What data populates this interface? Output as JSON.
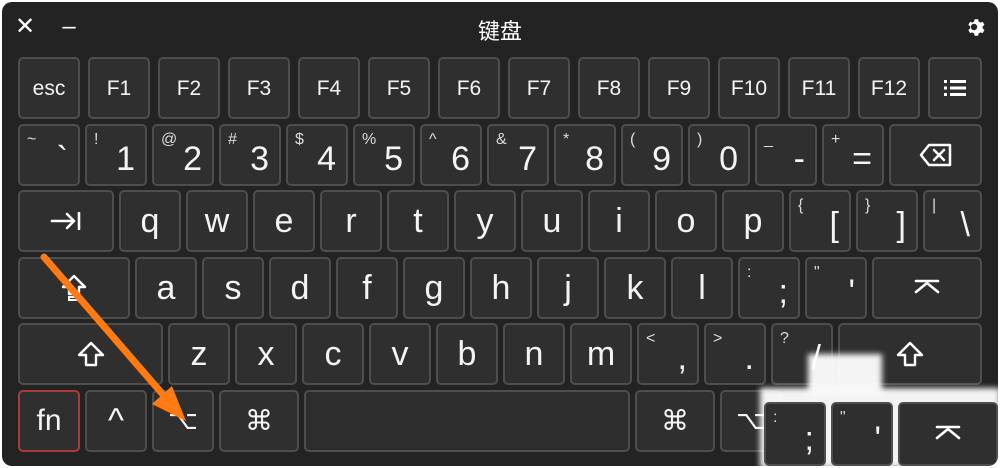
{
  "window": {
    "title": "键盘",
    "close_glyph": "✕",
    "minimize_glyph": "–",
    "settings_icon": "gear-icon"
  },
  "colors": {
    "background": "#232323",
    "key_fill": "#2f2f2f",
    "key_border": "#4e4e4e",
    "fn_border": "#a83b3b",
    "arrow": "#ff7a12"
  },
  "keys": {
    "row1": [
      "esc",
      "F1",
      "F2",
      "F3",
      "F4",
      "F5",
      "F6",
      "F7",
      "F8",
      "F9",
      "F10",
      "F11",
      "F12"
    ],
    "row2": [
      {
        "sym": "~",
        "main": "`"
      },
      {
        "sym": "!",
        "main": "1"
      },
      {
        "sym": "@",
        "main": "2"
      },
      {
        "sym": "#",
        "main": "3"
      },
      {
        "sym": "$",
        "main": "4"
      },
      {
        "sym": "%",
        "main": "5"
      },
      {
        "sym": "^",
        "main": "6"
      },
      {
        "sym": "&",
        "main": "7"
      },
      {
        "sym": "*",
        "main": "8"
      },
      {
        "sym": "(",
        "main": "9"
      },
      {
        "sym": ")",
        "main": "0"
      },
      {
        "sym": "_",
        "main": "-"
      },
      {
        "sym": "+",
        "main": "="
      }
    ],
    "row3": [
      "q",
      "w",
      "e",
      "r",
      "t",
      "y",
      "u",
      "i",
      "o",
      "p"
    ],
    "row3_brackets": [
      {
        "sym": "{",
        "main": "["
      },
      {
        "sym": "}",
        "main": "]"
      },
      {
        "sym": "|",
        "main": "\\"
      }
    ],
    "row4": [
      "a",
      "s",
      "d",
      "f",
      "g",
      "h",
      "j",
      "k",
      "l"
    ],
    "row4_punct": [
      {
        "sym": ":",
        "main": ";"
      },
      {
        "sym": "\"",
        "main": "'"
      }
    ],
    "row5": [
      "z",
      "x",
      "c",
      "v",
      "b",
      "n",
      "m"
    ],
    "row5_punct": [
      {
        "sym": "<",
        "main": ","
      },
      {
        "sym": ">",
        "main": "."
      },
      {
        "sym": "?",
        "main": "/"
      }
    ],
    "row6": {
      "fn": "fn",
      "ctrl": "^",
      "option": "⌥",
      "command_left": "⌘",
      "command_right": "⌘",
      "option_right": "⌥",
      "punct_semicolon": {
        "sym": ":",
        "main": ";"
      },
      "punct_quote": {
        "sym": "\"",
        "main": "'"
      }
    }
  }
}
